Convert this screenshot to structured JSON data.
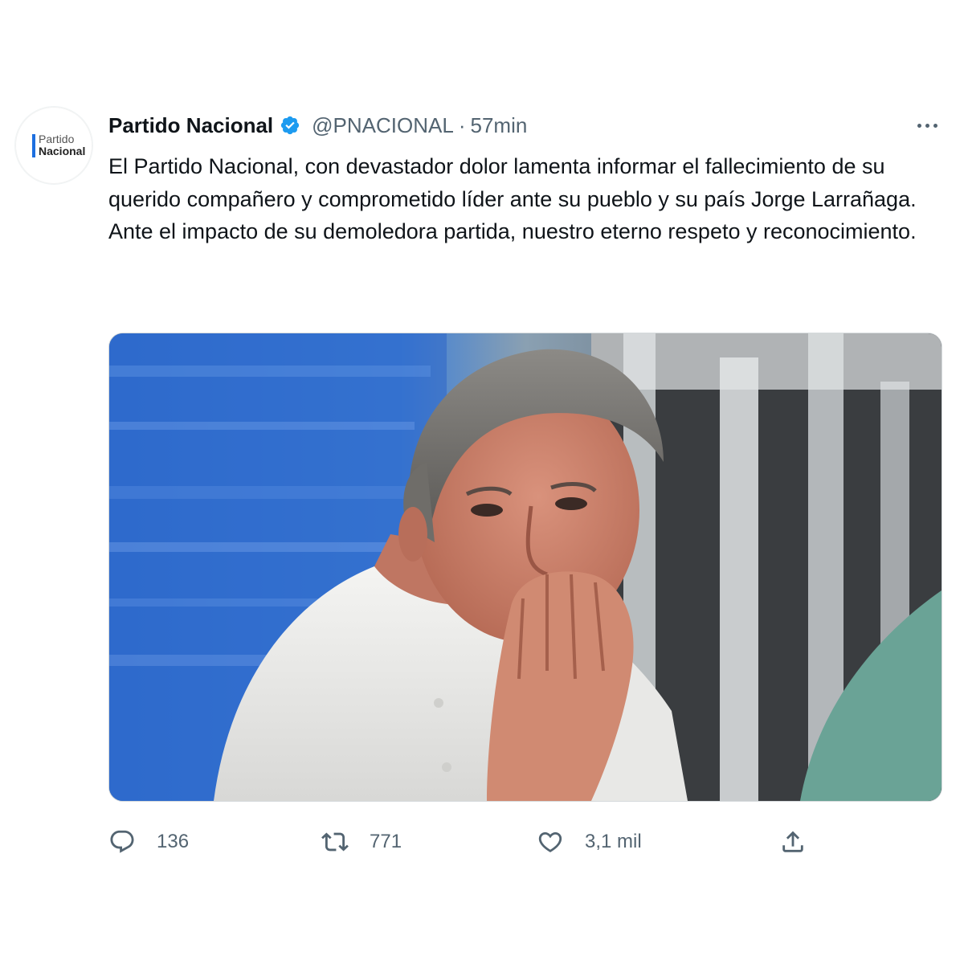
{
  "tweet": {
    "avatar": {
      "line1": "Partido",
      "line2": "Nacional"
    },
    "display_name": "Partido Nacional",
    "handle": "@PNACIONAL",
    "separator": "·",
    "time": "57min",
    "text_lines": [
      "El Partido Nacional, con devastador dolor lamenta informar el fallecimiento de su querido compañero y comprometido líder ante su pueblo y su país Jorge Larrañaga.",
      "Ante el impacto de su demoledora partida, nuestro eterno respeto y reconocimiento."
    ]
  },
  "actions": {
    "replies": "136",
    "retweets": "771",
    "likes": "3,1 mil"
  },
  "colors": {
    "text": "#0f1419",
    "muted": "#536471",
    "verified": "#1d9bf0",
    "brand_bar": "#1d6fe0"
  },
  "icons": {
    "verified": "verified-badge-icon",
    "more": "more-dots-icon",
    "reply": "reply-bubble-icon",
    "retweet": "retweet-icon",
    "like": "heart-icon",
    "share": "share-icon"
  }
}
